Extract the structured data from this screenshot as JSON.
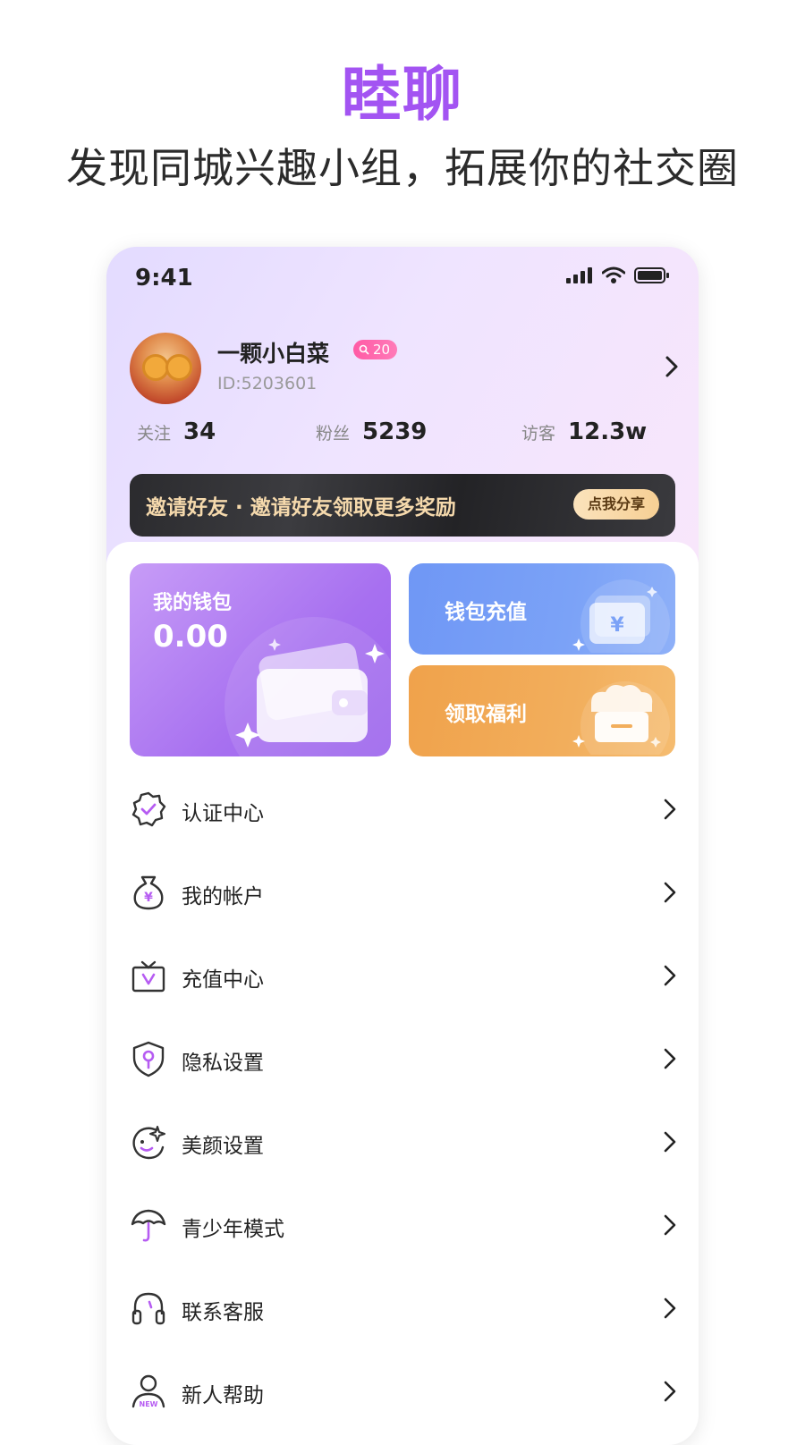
{
  "promo": {
    "title": "睦聊",
    "subtitle": "发现同城兴趣小组，拓展你的社交圈"
  },
  "status_bar": {
    "time": "9:41"
  },
  "profile": {
    "name": "一颗小白菜",
    "level": "20",
    "id": "ID:5203601"
  },
  "stats": [
    {
      "label": "关注",
      "value": "34"
    },
    {
      "label": "粉丝",
      "value": "5239"
    },
    {
      "label": "访客",
      "value": "12.3w"
    }
  ],
  "invite": {
    "text": "邀请好友 · 邀请好友领取更多奖励",
    "button": "点我分享"
  },
  "wallet": {
    "title": "我的钱包",
    "amount": "0.00"
  },
  "recharge": {
    "label": "钱包充值"
  },
  "welfare": {
    "label": "领取福利"
  },
  "menu": [
    {
      "label": "认证中心",
      "icon": "badge-check-icon"
    },
    {
      "label": "我的帐户",
      "icon": "money-bag-icon"
    },
    {
      "label": "充值中心",
      "icon": "tv-recharge-icon"
    },
    {
      "label": "隐私设置",
      "icon": "shield-key-icon"
    },
    {
      "label": "美颜设置",
      "icon": "beauty-face-icon"
    },
    {
      "label": "青少年模式",
      "icon": "umbrella-icon"
    },
    {
      "label": "联系客服",
      "icon": "headset-icon"
    },
    {
      "label": "新人帮助",
      "icon": "new-user-icon"
    }
  ],
  "colors": {
    "brand": "#a354f2",
    "wallet_card": "#a770f0",
    "recharge_card": "#7ba2f7",
    "welfare_card": "#f2ae5c",
    "level_badge": "#ff5aa5",
    "invite_text": "#f5d9ac"
  }
}
